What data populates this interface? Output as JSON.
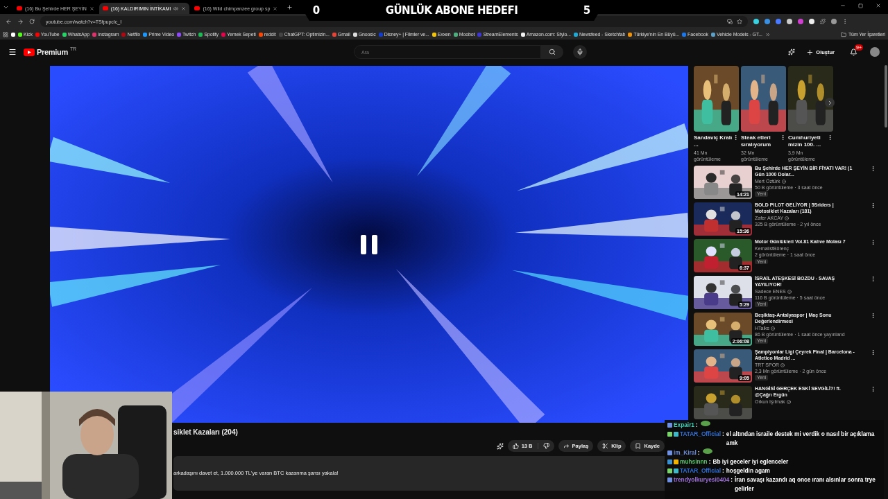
{
  "browser": {
    "tabs": [
      {
        "title": "(16) Bu Şehirde HER ŞEYİN",
        "selected": false,
        "playing_audio": false
      },
      {
        "title": "(16) KALDIRIMIN İNTİKAMI",
        "selected": true,
        "playing_audio": true
      },
      {
        "title": "(16) Wild chimpanzee group sp",
        "selected": false,
        "playing_audio": false
      }
    ],
    "address": "youtube.com/watch?v=TSfpupcIc_I",
    "bookmarks": [
      {
        "kind": "icon",
        "color": "#ffffff"
      },
      {
        "kind": "link",
        "label": "Kick",
        "color": "#53fc18"
      },
      {
        "kind": "link",
        "label": "YouTube",
        "color": "#ff0000"
      },
      {
        "kind": "link",
        "label": "WhatsApp",
        "color": "#25d366"
      },
      {
        "kind": "link",
        "label": "Instagram",
        "color": "#e1306c"
      },
      {
        "kind": "link",
        "label": "Netflix",
        "color": "#b20710"
      },
      {
        "kind": "link",
        "label": "Prime Video",
        "color": "#1a98ff"
      },
      {
        "kind": "link",
        "label": "Twitch",
        "color": "#9146ff"
      },
      {
        "kind": "link",
        "label": "Spotify",
        "color": "#1db954"
      },
      {
        "kind": "link",
        "label": "Yemek Sepeti",
        "color": "#ea004b"
      },
      {
        "kind": "link",
        "label": "reddit",
        "color": "#ff4500"
      },
      {
        "kind": "link",
        "label": "ChatGPT: Optimizin...",
        "color": "#444444"
      },
      {
        "kind": "link",
        "label": "Gmail",
        "color": "#ea4335"
      },
      {
        "kind": "link",
        "label": "Gnoosic",
        "color": "#dddddd"
      },
      {
        "kind": "link",
        "label": "Disney+ | Filmler ve...",
        "color": "#113ccf"
      },
      {
        "kind": "link",
        "label": "Exxen",
        "color": "#f5c400"
      },
      {
        "kind": "link",
        "label": "Moobot",
        "color": "#4caf7d"
      },
      {
        "kind": "link",
        "label": "StreamElements",
        "color": "#3d34d3"
      },
      {
        "kind": "link",
        "label": "Amazon.com: Stylo...",
        "color": "#f2f2f2"
      },
      {
        "kind": "link",
        "label": "Newsfeed - Sketchfab",
        "color": "#1caad9"
      },
      {
        "kind": "link",
        "label": "Türkiye'nin En Büyü...",
        "color": "#f39200"
      },
      {
        "kind": "link",
        "label": "Facebook",
        "color": "#1877f2"
      },
      {
        "kind": "link",
        "label": "Vehicle Models - GT...",
        "color": "#5aa0c8"
      }
    ],
    "all_bookmarks": "Tüm Yer İşaretleri"
  },
  "overlay": {
    "goal_current": "0",
    "goal_title": "GÜNLÜK ABONE HEDEFI",
    "goal_target": "5"
  },
  "header": {
    "logo": "Premium",
    "region": "TR",
    "search_placeholder": "Ara",
    "create": "Oluştur",
    "notifications": "9+"
  },
  "video": {
    "paused": true,
    "title": "siklet Kazaları (204)",
    "likes": "13 B",
    "share": "Paylaş",
    "clip": "Klip",
    "save": "Kayde",
    "description": "arkadaşını davet et, 1.000.000 TL'ye varan BTC kazanma şansı yakala!"
  },
  "shorts": [
    {
      "title": "Sandaviç Kralı ...",
      "views": "41 Mn görüntüleme"
    },
    {
      "title": "Steak etleri sıralıyorum",
      "views": "32 Mn görüntüleme"
    },
    {
      "title": "Cumhuriyeti mizin 100. ...",
      "views": "3,9 Mn görüntüleme"
    }
  ],
  "recommendations": [
    {
      "title": "Bu Şehirde HER ŞEYİN BİR FİYATI VAR! (1 Gün 1000 Dolar...",
      "channel": "Mert Öztürk",
      "verified": true,
      "meta": "50 B görüntüleme · 3 saat önce",
      "badge": "Yeni",
      "duration": "14:21"
    },
    {
      "title": "BOLD PILOT GELİYOR | 5Sriders | Motosiklet Kazaları (181)",
      "channel": "Zafer AKCAY",
      "verified": true,
      "meta": "325 B görüntüleme · 2 yıl önce",
      "duration": "15:36"
    },
    {
      "title": "Motor Günlükleri Vol.81 Kahve Molası 7",
      "channel": "KemalistBörenç",
      "verified": false,
      "meta": "2 görüntüleme · 1 saat önce",
      "badge": "Yeni",
      "duration": "6:37"
    },
    {
      "title": "İSRAİL ATEŞKESİ BOZDU - SAVAŞ YAYILIYOR!",
      "channel": "Sadece ENES",
      "verified": true,
      "meta": "116 B görüntüleme · 5 saat önce",
      "badge": "Yeni",
      "duration": "5:29"
    },
    {
      "title": "Beşiktaş-Antalyaspor | Maç Sonu Değerlendirmesi",
      "channel": "HTalks",
      "verified": true,
      "meta": "86 B görüntüleme · 1 saat önce yayınland",
      "badge": "Yeni",
      "duration": "2:06:08"
    },
    {
      "title": "Şampiyonlar Ligi Çeyrek Final | Barcelona - Atletico Madrid ...",
      "channel": "TRT SPOR",
      "verified": true,
      "meta": "2,3 Mn görüntüleme · 2 gün önce",
      "badge": "Yeni",
      "duration": "9:05"
    },
    {
      "title": "HANGİSİ GERÇEK ESKİ SEVGİLİ?! ft. @Çağrı Ergün",
      "channel": "Orkun Işıtmak",
      "verified": true
    }
  ],
  "chat": [
    {
      "user": "Expair1",
      "separator": ":",
      "color": "#3fd0b8",
      "badges": [
        {
          "color": "#6f8fe0"
        }
      ]
    },
    {
      "user": "TATAR_Official",
      "separator": ":",
      "color": "#2f6fd6",
      "badges": [
        {
          "color": "#7ad36b"
        },
        {
          "color": "#3fb8c8"
        }
      ],
      "text": "el altından israile destek mi verdik o nasıl bir açıklama amk"
    },
    {
      "user": "im_Kiral",
      "separator": ":",
      "color": "#6b8bd8",
      "badges": [
        {
          "color": "#6f8fe0"
        }
      ]
    },
    {
      "user": "muhsinnn",
      "separator": ":",
      "color": "#58c46a",
      "badges": [
        {
          "color": "#3a8fd0"
        },
        {
          "color": "#f0b400"
        }
      ],
      "text": "Bb iyi geceler iyi eglenceler"
    },
    {
      "user": "TATAR_Official",
      "separator": ":",
      "color": "#2f6fd6",
      "badges": [
        {
          "color": "#7ad36b"
        },
        {
          "color": "#3fb8c8"
        }
      ],
      "text": "hoşgeldin agam"
    },
    {
      "user": "trendyolkuryesi0404",
      "separator": ":",
      "color": "#9b6fd6",
      "badges": [
        {
          "color": "#6f8fe0"
        }
      ],
      "text": "İran savaşı kazandı aq once ıranı alsınlar sonra trye gelirler"
    }
  ]
}
